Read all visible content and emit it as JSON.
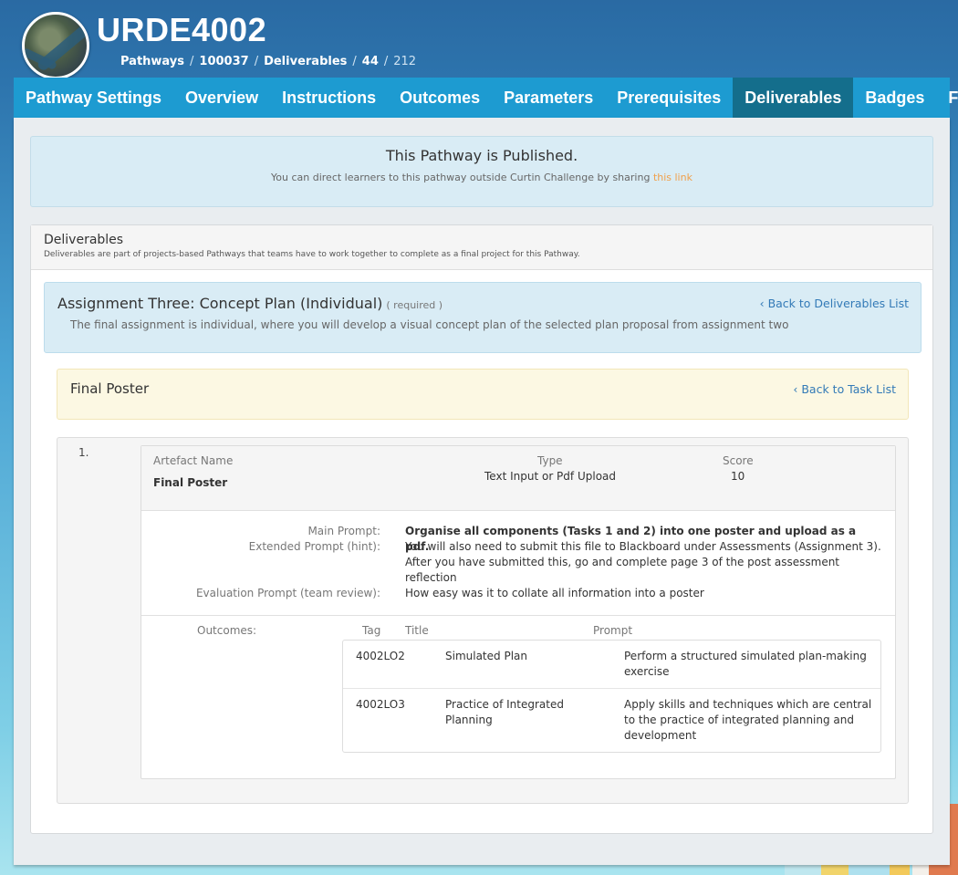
{
  "header": {
    "course_code": "URDE4002",
    "breadcrumb": {
      "pathways": "Pathways",
      "pathway_id": "100037",
      "deliverables": "Deliverables",
      "deliverable_id": "44",
      "task_id": "212"
    }
  },
  "tabs": [
    {
      "label": "Pathway Settings",
      "active": false
    },
    {
      "label": "Overview",
      "active": false
    },
    {
      "label": "Instructions",
      "active": false
    },
    {
      "label": "Outcomes",
      "active": false
    },
    {
      "label": "Parameters",
      "active": false
    },
    {
      "label": "Prerequisites",
      "active": false
    },
    {
      "label": "Deliverables",
      "active": true
    },
    {
      "label": "Badges",
      "active": false
    },
    {
      "label": "Finish",
      "active": false
    }
  ],
  "published": {
    "title": "This Pathway is Published.",
    "text": "You can direct learners to this pathway outside Curtin Challenge by sharing ",
    "link": "this link"
  },
  "deliverables": {
    "title": "Deliverables",
    "subtitle": "Deliverables are part of projects-based Pathways that teams have to work together to complete as a final project for this Pathway."
  },
  "assignment": {
    "title": "Assignment Three: Concept Plan (Individual)",
    "required": "( required )",
    "description": "The final assignment is individual, where you will develop a visual concept plan of the selected plan proposal from assignment two",
    "back_link": "Back to Deliverables List"
  },
  "task": {
    "title": "Final Poster",
    "back_link": "Back to Task List"
  },
  "artefact": {
    "number": "1.",
    "name_label": "Artefact Name",
    "name": "Final Poster",
    "type_label": "Type",
    "type": "Text Input or Pdf Upload",
    "score_label": "Score",
    "score": "10",
    "main_prompt_label": "Main Prompt:",
    "main_prompt": "Organise all components (Tasks 1 and 2) into one poster and upload as a pdf.",
    "extended_prompt_label": "Extended Prompt (hint):",
    "extended_prompt": "You will also need to submit this file to Blackboard under Assessments (Assignment 3). After you have submitted this, go and complete page 3 of the post assessment reflection",
    "evaluation_prompt_label": "Evaluation Prompt (team review):",
    "evaluation_prompt": "How easy was it to collate all information into a poster",
    "outcomes_label": "Outcomes:",
    "outcome_headers": {
      "tag": "Tag",
      "title": "Title",
      "prompt": "Prompt"
    },
    "outcomes": [
      {
        "tag": "4002LO2",
        "title": "Simulated Plan",
        "prompt": "Perform a structured simulated plan-making exercise"
      },
      {
        "tag": "4002LO3",
        "title": "Practice of Integrated Planning",
        "prompt": "Apply skills and techniques which are central to the practice of integrated planning and development"
      }
    ]
  },
  "icons": {
    "back": "chevron-left-icon"
  },
  "colors": {
    "tab_bar": "#1d9bd1",
    "tab_active": "#146e8c",
    "link": "#337ab7",
    "link_orange": "#f0a04b",
    "info_bg": "#d9ecf5",
    "warning_bg": "#fcf8e3"
  }
}
